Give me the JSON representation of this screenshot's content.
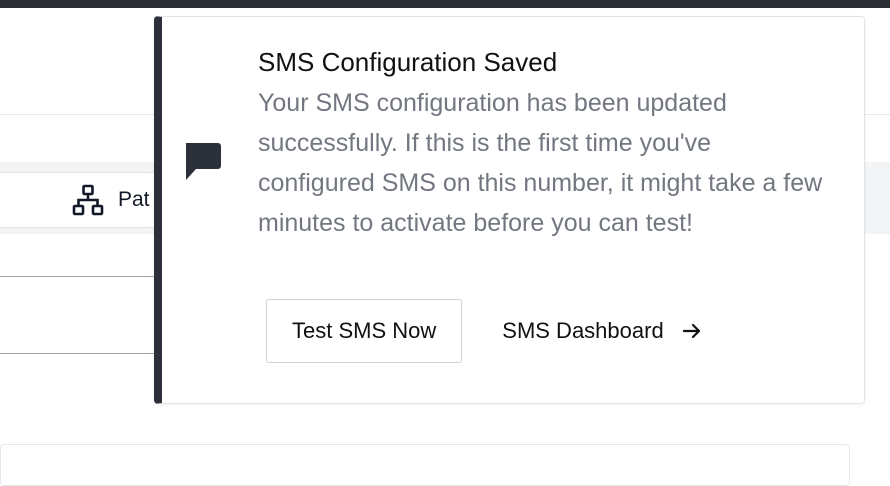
{
  "background": {
    "tab": {
      "label": "Pat",
      "icon": "sitemap-icon"
    }
  },
  "toast": {
    "icon": "chat-bubble-icon",
    "title": "SMS Configuration Saved",
    "message": "Your SMS configuration has been updated successfully. If this is the first time you've configured SMS on this number, it might take a few minutes to activate before you can test!",
    "primary_button_label": "Test SMS Now",
    "secondary_link_label": "SMS Dashboard",
    "secondary_link_icon": "arrow-right-icon",
    "accent_color": "#2b303b"
  }
}
